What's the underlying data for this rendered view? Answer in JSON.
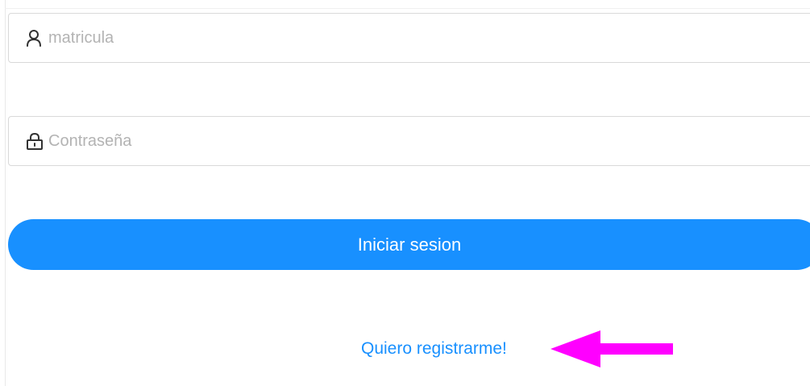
{
  "login_form": {
    "username": {
      "placeholder": "matricula",
      "value": "",
      "icon": "user-icon"
    },
    "password": {
      "placeholder": "Contraseña",
      "value": "",
      "icon": "lock-icon"
    },
    "submit_label": "Iniciar sesion",
    "register_link_label": "Quiero registrarme!"
  },
  "colors": {
    "primary": "#1890ff",
    "annotation_arrow": "#ff00ff",
    "border": "#d9d9d9",
    "placeholder": "#b3b3b3"
  }
}
